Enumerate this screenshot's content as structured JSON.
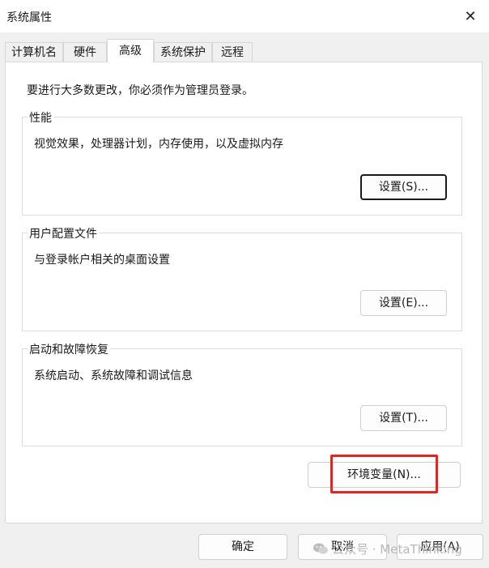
{
  "window": {
    "title": "系统属性",
    "close_glyph": "✕"
  },
  "tabs": [
    {
      "label": "计算机名",
      "active": false
    },
    {
      "label": "硬件",
      "active": false
    },
    {
      "label": "高级",
      "active": true
    },
    {
      "label": "系统保护",
      "active": false
    },
    {
      "label": "远程",
      "active": false
    }
  ],
  "admin_note": "要进行大多数更改，你必须作为管理员登录。",
  "groups": {
    "performance": {
      "label": "性能",
      "description": "视觉效果，处理器计划，内存使用，以及虚拟内存",
      "button": "设置(S)..."
    },
    "user_profiles": {
      "label": "用户配置文件",
      "description": "与登录帐户相关的桌面设置",
      "button": "设置(E)..."
    },
    "startup_recovery": {
      "label": "启动和故障恢复",
      "description": "系统启动、系统故障和调试信息",
      "button": "设置(T)..."
    }
  },
  "env_button": "环境变量(N)...",
  "footer": {
    "ok": "确定",
    "cancel": "取消",
    "apply": "应用(A)"
  },
  "watermark": "公众号 · MetaThinking",
  "colors": {
    "highlight_box": "#e8231d",
    "window_bg": "#f0f0f0",
    "panel_bg": "#ffffff"
  }
}
